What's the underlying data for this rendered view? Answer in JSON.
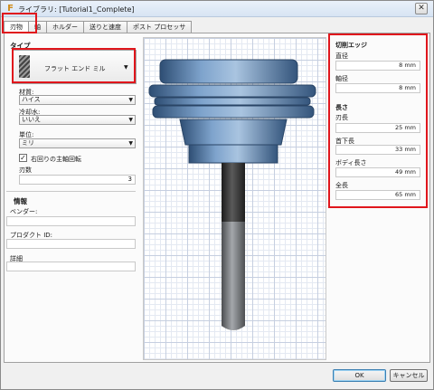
{
  "window": {
    "title": "ライブラリ: [Tutorial1_Complete]",
    "close_glyph": "✕",
    "app_icon_glyph": "F"
  },
  "tabs": [
    {
      "label": "刃物"
    },
    {
      "label": "軸"
    },
    {
      "label": "ホルダー"
    },
    {
      "label": "送りと速度"
    },
    {
      "label": "ポスト プロセッサ"
    }
  ],
  "left": {
    "type_heading": "タイプ",
    "type_value": "フラット エンド ミル",
    "material_label": "材質:",
    "material_value": "ハイス",
    "coolant_label": "冷却水:",
    "coolant_value": "いいえ",
    "unit_label": "単位:",
    "unit_value": "ミリ",
    "clockwise_label": "右回りの主軸回転",
    "clockwise_checked": true,
    "flutes_label": "刃数",
    "flutes_value": "3",
    "info_heading": "情報",
    "vendor_label": "ベンダー:",
    "product_id_label": "プロダクト ID:",
    "notes_label": "詳細"
  },
  "right": {
    "cutting_edge_heading": "切削エッジ",
    "diameter_label": "直径",
    "diameter_value": "8 mm",
    "shaft_diameter_label": "軸径",
    "shaft_diameter_value": "8 mm",
    "length_heading": "長さ",
    "flute_length_label": "刃長",
    "flute_length_value": "25 mm",
    "shoulder_length_label": "首下長",
    "shoulder_length_value": "33 mm",
    "body_length_label": "ボディ長さ",
    "body_length_value": "49 mm",
    "overall_length_label": "全長",
    "overall_length_value": "65 mm"
  },
  "buttons": {
    "ok": "OK",
    "cancel": "キャンセル"
  },
  "colors": {
    "highlight": "#e0161c",
    "holder": "#5b82ad",
    "tool_dark": "#3a3a3a",
    "tool_shaft": "#7d7f82"
  }
}
